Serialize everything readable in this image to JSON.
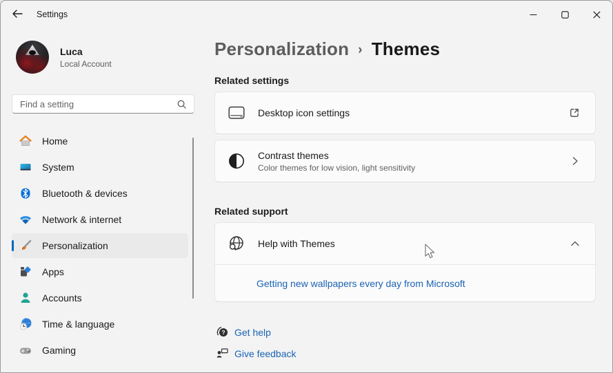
{
  "window": {
    "title": "Settings",
    "controls": {
      "minimize": "minimize",
      "maximize": "maximize",
      "close": "close"
    }
  },
  "profile": {
    "name": "Luca",
    "account_type": "Local Account"
  },
  "search": {
    "placeholder": "Find a setting"
  },
  "sidebar": {
    "items": [
      {
        "label": "Home",
        "icon": "home-icon",
        "selected": false
      },
      {
        "label": "System",
        "icon": "system-icon",
        "selected": false
      },
      {
        "label": "Bluetooth & devices",
        "icon": "bluetooth-icon",
        "selected": false
      },
      {
        "label": "Network & internet",
        "icon": "network-icon",
        "selected": false
      },
      {
        "label": "Personalization",
        "icon": "personalization-icon",
        "selected": true
      },
      {
        "label": "Apps",
        "icon": "apps-icon",
        "selected": false
      },
      {
        "label": "Accounts",
        "icon": "accounts-icon",
        "selected": false
      },
      {
        "label": "Time & language",
        "icon": "time-language-icon",
        "selected": false
      },
      {
        "label": "Gaming",
        "icon": "gaming-icon",
        "selected": false
      }
    ]
  },
  "breadcrumb": {
    "parent": "Personalization",
    "separator": "›",
    "current": "Themes"
  },
  "sections": {
    "related_settings": {
      "title": "Related settings",
      "cards": [
        {
          "title": "Desktop icon settings",
          "icon": "desktop-settings-icon",
          "action": "external-link-icon"
        },
        {
          "title": "Contrast themes",
          "subtitle": "Color themes for low vision, light sensitivity",
          "icon": "contrast-icon",
          "action": "chevron-right-icon"
        }
      ]
    },
    "related_support": {
      "title": "Related support",
      "card": {
        "title": "Help with Themes",
        "icon": "globe-search-icon",
        "action": "chevron-up-icon",
        "links": [
          "Getting new wallpapers every day from Microsoft"
        ]
      }
    }
  },
  "footer": {
    "get_help": "Get help",
    "give_feedback": "Give feedback"
  },
  "colors": {
    "accent": "#0067c0",
    "link": "#1a63b4",
    "window_bg": "#f3f3f3",
    "card_bg": "#fbfbfb",
    "card_border": "#e7e7e7",
    "selected_nav_bg": "#eaeaea"
  }
}
